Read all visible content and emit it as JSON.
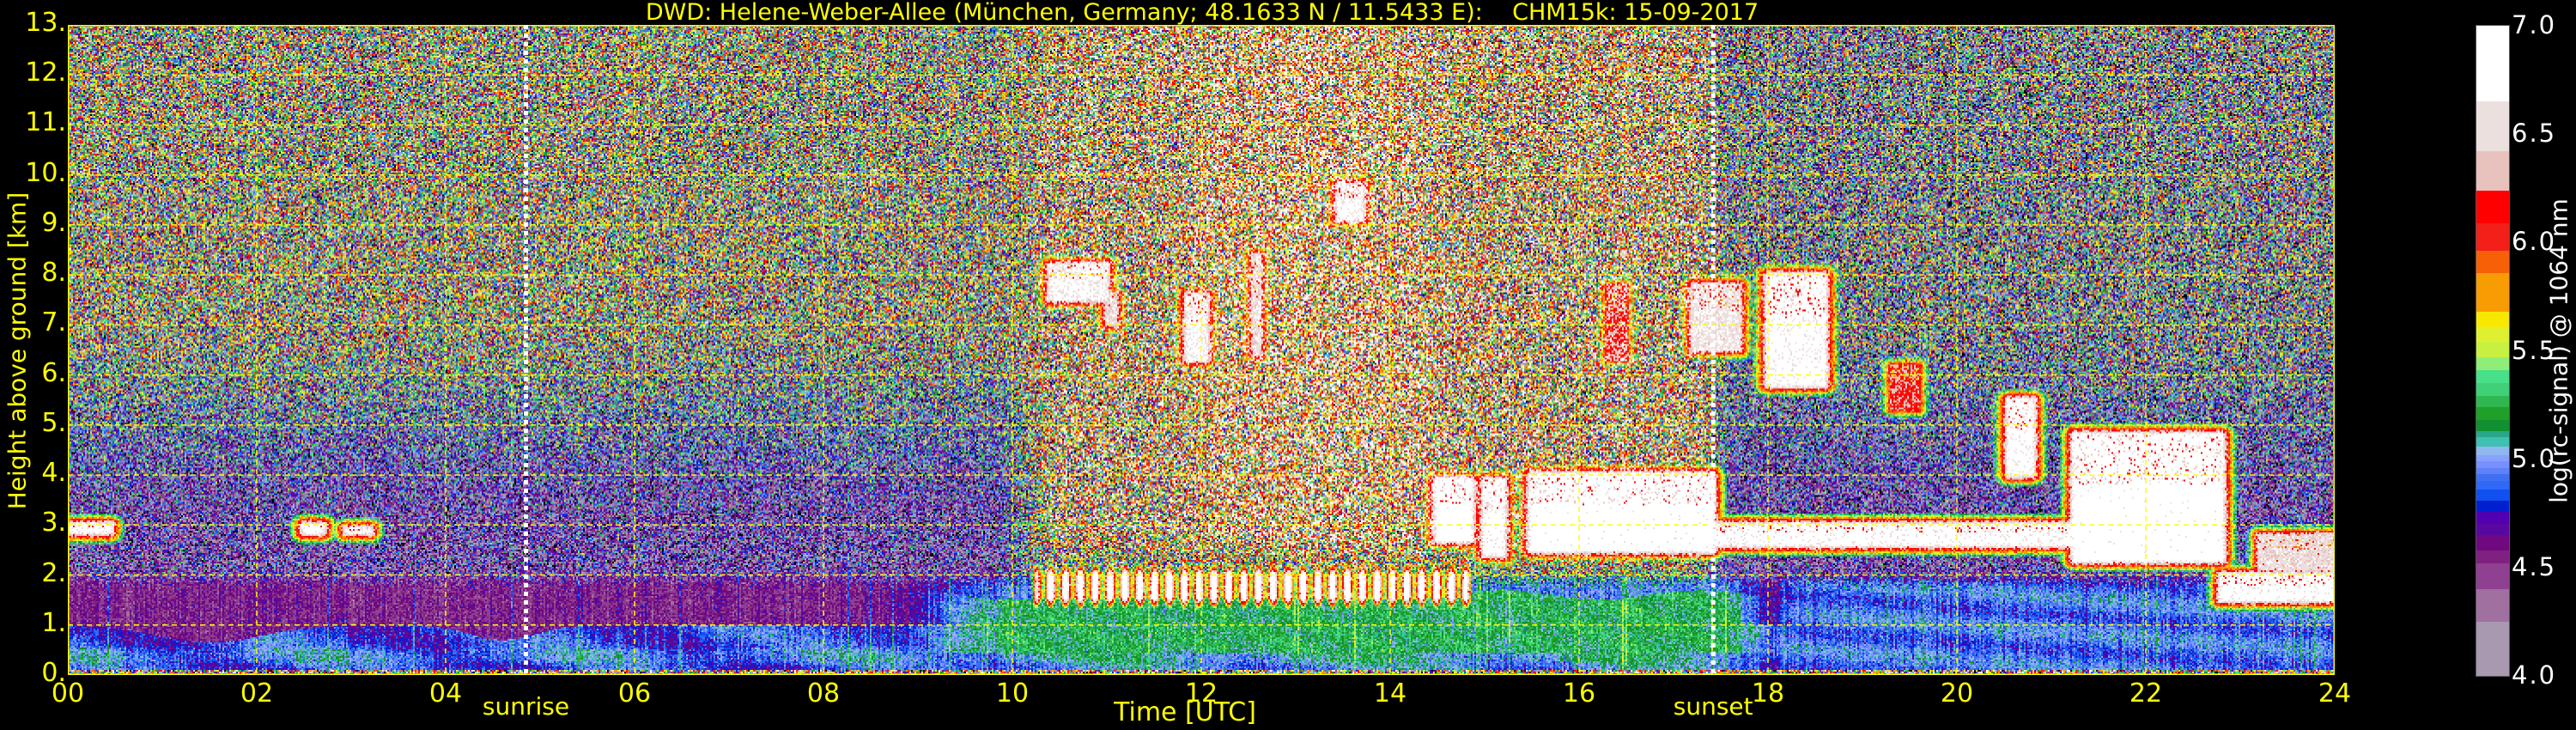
{
  "title": "DWD: Helene-Weber-Allee (München, Germany; 48.1633 N / 11.5433 E):    CHM15k: 15-09-2017",
  "axes": {
    "xlabel": "Time [UTC]",
    "ylabel": "Height above ground [km]",
    "xticks": [
      "00",
      "02",
      "04",
      "06",
      "08",
      "10",
      "12",
      "14",
      "16",
      "18",
      "20",
      "22",
      "24"
    ],
    "yticks": [
      "0.",
      "1.",
      "2.",
      "3.",
      "4.",
      "5.",
      "6.",
      "7.",
      "8.",
      "9.",
      "10.",
      "11.",
      "12.",
      "13."
    ],
    "text_color": "#ffff00",
    "grid_color": "#ffff00"
  },
  "sun_events": [
    {
      "label": "sunrise",
      "time_utc": 4.85,
      "line_color": "#ffffff"
    },
    {
      "label": "sunset",
      "time_utc": 17.42,
      "line_color": "#ffffff"
    }
  ],
  "colorbar": {
    "label": "log(rc-signal) @ 1064 nm",
    "ticks": [
      "7.0",
      "6.5",
      "6.0",
      "5.5",
      "5.0",
      "4.5",
      "4.0"
    ],
    "tick_values": [
      7.0,
      6.5,
      6.0,
      5.5,
      5.0,
      4.5,
      4.0
    ]
  },
  "chart_data": {
    "type": "heatmap",
    "x_quantity": "time UTC [h]",
    "y_quantity": "height above ground [km]",
    "xlim": [
      0,
      24
    ],
    "ylim": [
      0,
      13
    ],
    "clim": [
      4.0,
      7.0
    ],
    "grid": true,
    "under_color": "#000000",
    "colormap": [
      {
        "from": 6.65,
        "color": "#ffffff"
      },
      {
        "from": 6.42,
        "color": "#ece0df"
      },
      {
        "from": 6.24,
        "color": "#e8c2bd"
      },
      {
        "from": 6.09,
        "color": "#ff0000"
      },
      {
        "from": 5.96,
        "color": "#f22018"
      },
      {
        "from": 5.86,
        "color": "#f86008"
      },
      {
        "from": 5.68,
        "color": "#f89c04"
      },
      {
        "from": 5.61,
        "color": "#f8e800"
      },
      {
        "from": 5.54,
        "color": "#e0f030"
      },
      {
        "from": 5.47,
        "color": "#c8f040"
      },
      {
        "from": 5.41,
        "color": "#90ee78"
      },
      {
        "from": 5.35,
        "color": "#48e088"
      },
      {
        "from": 5.29,
        "color": "#40d078"
      },
      {
        "from": 5.24,
        "color": "#30b850"
      },
      {
        "from": 5.18,
        "color": "#20a028"
      },
      {
        "from": 5.13,
        "color": "#109030"
      },
      {
        "from": 5.1,
        "color": "#28a888"
      },
      {
        "from": 5.06,
        "color": "#40c0b0"
      },
      {
        "from": 5.02,
        "color": "#90b8f0"
      },
      {
        "from": 4.99,
        "color": "#88a0ff"
      },
      {
        "from": 4.96,
        "color": "#7890ff"
      },
      {
        "from": 4.93,
        "color": "#6080f8"
      },
      {
        "from": 4.9,
        "color": "#4070f0"
      },
      {
        "from": 4.86,
        "color": "#3068f8"
      },
      {
        "from": 4.81,
        "color": "#1050f0"
      },
      {
        "from": 4.76,
        "color": "#0020d0"
      },
      {
        "from": 4.7,
        "color": "#5000b0"
      },
      {
        "from": 4.65,
        "color": "#5808a0"
      },
      {
        "from": 4.58,
        "color": "#700880"
      },
      {
        "from": 4.52,
        "color": "#802080"
      },
      {
        "from": 4.4,
        "color": "#904090"
      },
      {
        "from": 4.25,
        "color": "#a070a0"
      },
      {
        "from": 4.0,
        "color": "#a898b0"
      }
    ],
    "layers": [
      {
        "kind": "cloud",
        "t": [
          0.0,
          0.45
        ],
        "h": [
          2.85,
          3.0
        ],
        "value": 6.8
      },
      {
        "kind": "cloud",
        "t": [
          2.5,
          2.7
        ],
        "h": [
          2.85,
          3.0
        ],
        "value": 6.8
      },
      {
        "kind": "cloud",
        "t": [
          2.95,
          3.2
        ],
        "h": [
          2.85,
          2.92
        ],
        "value": 6.8
      },
      {
        "kind": "cloud",
        "t": [
          10.4,
          11.0
        ],
        "h": [
          7.5,
          8.2
        ],
        "value": 6.7
      },
      {
        "kind": "cloud",
        "t": [
          11.0,
          11.1
        ],
        "h": [
          7.0,
          7.6
        ],
        "value": 6.5
      },
      {
        "kind": "cloud",
        "t": [
          11.85,
          12.05
        ],
        "h": [
          6.3,
          7.6
        ],
        "value": 6.7
      },
      {
        "kind": "cloud",
        "t": [
          12.55,
          12.62
        ],
        "h": [
          6.4,
          8.4
        ],
        "value": 6.5
      },
      {
        "kind": "cloud",
        "t": [
          13.45,
          13.7
        ],
        "h": [
          9.1,
          9.8
        ],
        "value": 6.7
      },
      {
        "kind": "cloud",
        "t": [
          14.5,
          14.85
        ],
        "h": [
          2.7,
          3.9
        ],
        "value": 6.9
      },
      {
        "kind": "cloud",
        "t": [
          15.0,
          15.2
        ],
        "h": [
          2.4,
          3.9
        ],
        "value": 6.8
      },
      {
        "kind": "cloud",
        "t": [
          15.5,
          17.4
        ],
        "h": [
          2.5,
          4.0
        ],
        "value": 6.9
      },
      {
        "kind": "cloud",
        "t": [
          16.3,
          16.5
        ],
        "h": [
          6.3,
          7.8
        ],
        "value": 6.2
      },
      {
        "kind": "cloud",
        "t": [
          17.2,
          17.7
        ],
        "h": [
          6.5,
          7.8
        ],
        "value": 6.6
      },
      {
        "kind": "cloud",
        "t": [
          18.0,
          18.6
        ],
        "h": [
          5.8,
          8.0
        ],
        "value": 6.8
      },
      {
        "kind": "cloud",
        "t": [
          17.3,
          21.3
        ],
        "h": [
          2.6,
          3.0
        ],
        "value": 6.8
      },
      {
        "kind": "cloud",
        "t": [
          19.3,
          19.6
        ],
        "h": [
          5.3,
          6.2
        ],
        "value": 6.2
      },
      {
        "kind": "cloud",
        "t": [
          20.55,
          20.8
        ],
        "h": [
          4.0,
          5.5
        ],
        "value": 6.8
      },
      {
        "kind": "cloud",
        "t": [
          21.25,
          22.8
        ],
        "h": [
          2.3,
          4.8
        ],
        "value": 6.9
      },
      {
        "kind": "cloud",
        "t": [
          22.8,
          24.0
        ],
        "h": [
          1.5,
          2.0
        ],
        "value": 6.8
      },
      {
        "kind": "cloud",
        "t": [
          23.2,
          24.0
        ],
        "h": [
          2.1,
          2.8
        ],
        "value": 6.5
      },
      {
        "kind": "cumulus",
        "t": [
          10.3,
          14.8
        ],
        "h": [
          1.55,
          2.0
        ],
        "value": 6.6
      },
      {
        "kind": "aerosol-layer",
        "t": [
          9.5,
          18.0
        ],
        "h": [
          0.45,
          1.6
        ],
        "value": 5.2
      },
      {
        "kind": "residual-layer",
        "t": [
          0.0,
          9.5
        ],
        "h": [
          1.0,
          1.8
        ],
        "value": 4.55
      },
      {
        "kind": "boundary-layer",
        "t": [
          0.0,
          24.0
        ],
        "h": [
          0.15,
          1.0
        ],
        "value": 4.9
      }
    ]
  }
}
